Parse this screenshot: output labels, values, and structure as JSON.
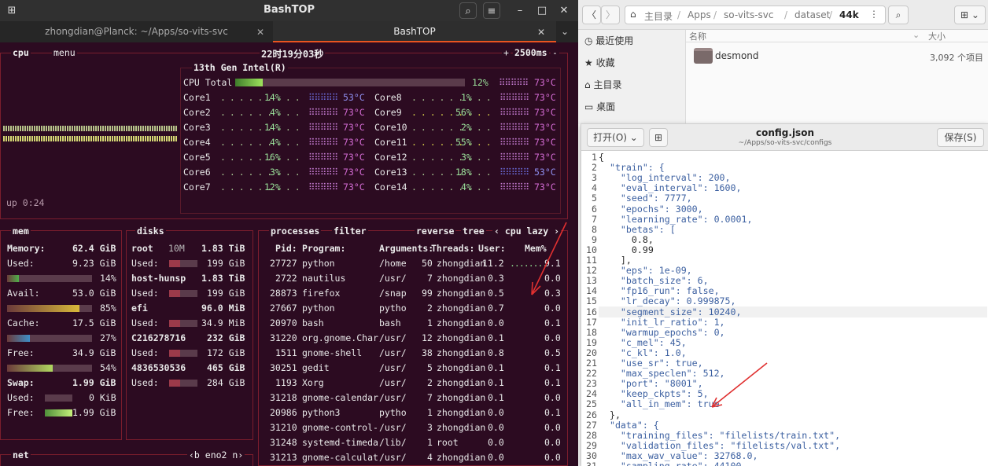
{
  "terminal": {
    "window_title": "BashTOP",
    "tabs": [
      "zhongdian@Planck: ~/Apps/so-vits-svc",
      "BashTOP"
    ],
    "cpu_box": {
      "label": "cpu",
      "menu": "menu",
      "clock": "22时19分03秒",
      "refresh": "2500ms",
      "plus": "+",
      "minus": "-",
      "model": "13th Gen Intel(R)",
      "total": {
        "name": "CPU Total",
        "pct": "12%",
        "temp": "73°C",
        "fill": 0.12
      },
      "cores_left": [
        {
          "name": "Core1",
          "pct": "14%",
          "temp": "53°C"
        },
        {
          "name": "Core2",
          "pct": "4%",
          "temp": "73°C"
        },
        {
          "name": "Core3",
          "pct": "14%",
          "temp": "73°C"
        },
        {
          "name": "Core4",
          "pct": "4%",
          "temp": "73°C"
        },
        {
          "name": "Core5",
          "pct": "16%",
          "temp": "73°C"
        },
        {
          "name": "Core6",
          "pct": "3%",
          "temp": "73°C"
        },
        {
          "name": "Core7",
          "pct": "12%",
          "temp": "73°C"
        }
      ],
      "cores_right": [
        {
          "name": "Core8",
          "pct": "1%",
          "temp": "73°C"
        },
        {
          "name": "Core9",
          "pct": "56%",
          "temp": "73°C"
        },
        {
          "name": "Core10",
          "pct": "2%",
          "temp": "73°C"
        },
        {
          "name": "Core11",
          "pct": "55%",
          "temp": "73°C"
        },
        {
          "name": "Core12",
          "pct": "3%",
          "temp": "73°C"
        },
        {
          "name": "Core13",
          "pct": "18%",
          "temp": "53°C"
        },
        {
          "name": "Core14",
          "pct": "4%",
          "temp": "73°C"
        }
      ],
      "uptime": "up 0:24"
    },
    "mem_box": {
      "label": "mem",
      "rows": [
        {
          "k": "Memory:",
          "v": "62.4 GiB",
          "bold": true
        },
        {
          "k": "Used:",
          "v": "9.23 GiB"
        },
        {
          "k": "",
          "v": "14%",
          "fill": 0.14
        },
        {
          "k": "Avail:",
          "v": "53.0 GiB"
        },
        {
          "k": "",
          "v": "85%",
          "fill": 0.85
        },
        {
          "k": "Cache:",
          "v": "17.5 GiB"
        },
        {
          "k": "",
          "v": "27%",
          "fill": 0.27
        },
        {
          "k": "Free:",
          "v": "34.9 GiB"
        },
        {
          "k": "",
          "v": "54%",
          "fill": 0.54
        },
        {
          "k": "Swap:",
          "v": "1.99 GiB",
          "bold": true
        },
        {
          "k": "Used:",
          "v": "0 KiB"
        },
        {
          "k": "Free:",
          "v": "1.99 GiB"
        }
      ]
    },
    "disks_box": {
      "label": "disks",
      "rows": [
        {
          "k": "root",
          "mid": "10M",
          "v": "1.83 TiB",
          "bold": true
        },
        {
          "k": "Used:",
          "v": "199 GiB"
        },
        {
          "k": "host-hunsp",
          "v": "1.83 TiB",
          "bold": true
        },
        {
          "k": "Used:",
          "v": "199 GiB"
        },
        {
          "k": "efi",
          "v": "96.0 MiB",
          "bold": true
        },
        {
          "k": "Used:",
          "v": "34.9 MiB"
        },
        {
          "k": "C216278716",
          "v": "232 GiB",
          "bold": true
        },
        {
          "k": "Used:",
          "v": "172 GiB"
        },
        {
          "k": "4836530536",
          "v": "465 GiB",
          "bold": true
        },
        {
          "k": "Used:",
          "v": "284 GiB"
        }
      ]
    },
    "proc_box": {
      "label": "processes",
      "filter": "filter",
      "reverse": "reverse",
      "tree": "tree",
      "sort": "‹ cpu lazy ›",
      "header": [
        "Pid:",
        "Program:",
        "Arguments:",
        "Threads:",
        "User:",
        "Mem%"
      ],
      "rows": [
        [
          "27727",
          "python",
          "/home",
          "50",
          "zhongdian",
          "11.2",
          "9.1"
        ],
        [
          "2722",
          "nautilus",
          "/usr/",
          "7",
          "zhongdian",
          "0.3",
          "0.0"
        ],
        [
          "28873",
          "firefox",
          "/snap",
          "99",
          "zhongdian",
          "0.5",
          "0.3"
        ],
        [
          "27667",
          "python",
          "pytho",
          "2",
          "zhongdian",
          "0.7",
          "0.0"
        ],
        [
          "20970",
          "bash",
          "bash",
          "1",
          "zhongdian",
          "0.0",
          "0.1"
        ],
        [
          "31220",
          "org.gnome.Char",
          "/usr/",
          "12",
          "zhongdian",
          "0.1",
          "0.0"
        ],
        [
          "1511",
          "gnome-shell",
          "/usr/",
          "38",
          "zhongdian",
          "0.8",
          "0.5"
        ],
        [
          "30251",
          "gedit",
          "/usr/",
          "5",
          "zhongdian",
          "0.1",
          "0.1"
        ],
        [
          "1193",
          "Xorg",
          "/usr/",
          "2",
          "zhongdian",
          "0.1",
          "0.1"
        ],
        [
          "31218",
          "gnome-calendar",
          "/usr/",
          "7",
          "zhongdian",
          "0.1",
          "0.0"
        ],
        [
          "20986",
          "python3",
          "pytho",
          "1",
          "zhongdian",
          "0.0",
          "0.1"
        ],
        [
          "31210",
          "gnome-control-",
          "/usr/",
          "3",
          "zhongdian",
          "0.0",
          "0.0"
        ],
        [
          "31248",
          "systemd-timeda",
          "/lib/",
          "1",
          "root",
          "0.0",
          "0.0"
        ],
        [
          "31213",
          "gnome-calculat",
          "/usr/",
          "4",
          "zhongdian",
          "0.0",
          "0.0"
        ]
      ]
    },
    "net_box": {
      "label": "net",
      "nav": "‹b eno2 n›"
    }
  },
  "file_manager": {
    "breadcrumb": [
      "主目录",
      "Apps",
      "so-vits-svc",
      "dataset",
      "44k"
    ],
    "sidebar": [
      "最近使用",
      "收藏",
      "主目录",
      "桌面"
    ],
    "col_name": "名称",
    "col_size": "大小",
    "item": {
      "name": "desmond",
      "size": "3,092 个项目"
    }
  },
  "gedit": {
    "open_label": "打开(O)",
    "title": "config.json",
    "path": "~/Apps/so-vits-svc/configs",
    "save_label": "保存(S)",
    "lines": [
      "{",
      "  \"train\": {",
      "    \"log_interval\": 200,",
      "    \"eval_interval\": 1600,",
      "    \"seed\": 7777,",
      "    \"epochs\": 3000,",
      "    \"learning_rate\": 0.0001,",
      "    \"betas\": [",
      "      0.8,",
      "      0.99",
      "    ],",
      "    \"eps\": 1e-09,",
      "    \"batch_size\": 6,",
      "    \"fp16_run\": false,",
      "    \"lr_decay\": 0.999875,",
      "    \"segment_size\": 10240,",
      "    \"init_lr_ratio\": 1,",
      "    \"warmup_epochs\": 0,",
      "    \"c_mel\": 45,",
      "    \"c_kl\": 1.0,",
      "    \"use_sr\": true,",
      "    \"max_speclen\": 512,",
      "    \"port\": \"8001\",",
      "    \"keep_ckpts\": 5,",
      "    \"all_in_mem\": true",
      "  },",
      "  \"data\": {",
      "    \"training_files\": \"filelists/train.txt\",",
      "    \"validation_files\": \"filelists/val.txt\",",
      "    \"max_wav_value\": 32768.0,",
      "    \"sampling_rate\": 44100,"
    ]
  }
}
